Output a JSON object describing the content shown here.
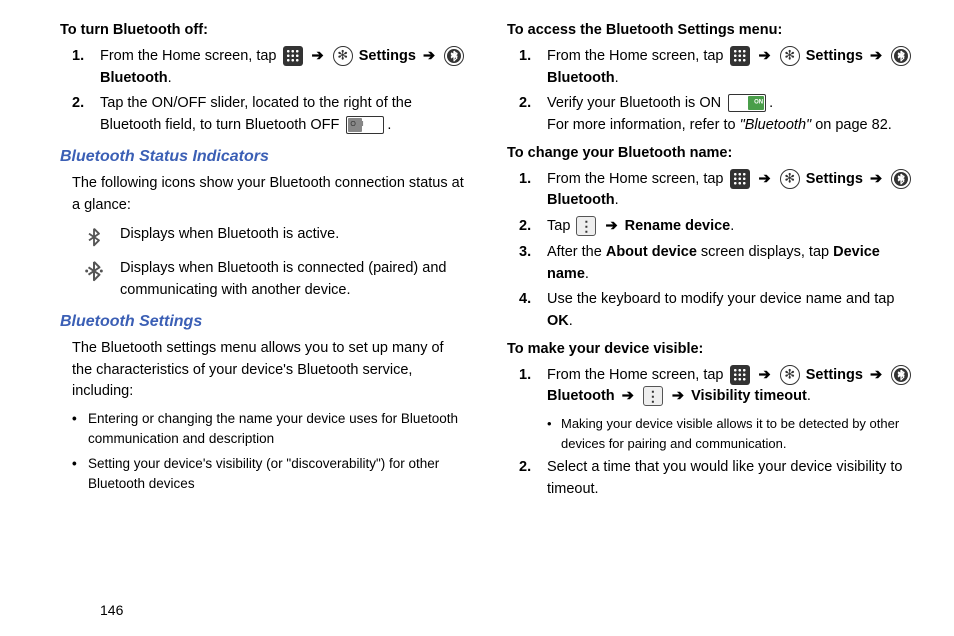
{
  "left": {
    "h_turn_off": "To turn Bluetooth off:",
    "off_steps": [
      {
        "pre": "From the Home screen, tap ",
        "mid": "Settings",
        "post": " ",
        "bt": "Bluetooth",
        "tail": "."
      },
      {
        "pre": "Tap the ON/OFF slider, located to the right of the Bluetooth field, to turn Bluetooth OFF ",
        "tail": "."
      }
    ],
    "h_status": "Bluetooth Status Indicators",
    "status_intro": "The following icons show your Bluetooth connection status at a glance:",
    "status_active": "Displays when Bluetooth is active.",
    "status_paired": "Displays when Bluetooth is connected (paired) and communicating with another device.",
    "h_settings": "Bluetooth Settings",
    "settings_intro": "The Bluetooth settings menu allows you to set up many of the characteristics of your device's Bluetooth service, including:",
    "bullets": [
      "Entering or changing the name your device uses for Bluetooth communication and description",
      "Setting your device's visibility (or \"discoverability\") for other Bluetooth devices"
    ]
  },
  "right": {
    "h_access": "To access the Bluetooth Settings menu:",
    "access_step1": {
      "pre": "From the Home screen, tap ",
      "settings": "Settings",
      "bt": "Bluetooth",
      "tail": "."
    },
    "access_step2_pre": "Verify your Bluetooth is ON ",
    "access_step2_tail": ".",
    "access_info_pre": "For more information, refer to ",
    "access_info_ref": "\"Bluetooth\"",
    "access_info_post": " on page 82.",
    "h_change": "To change your Bluetooth name:",
    "change_step1": {
      "pre": "From the Home screen, tap ",
      "settings": "Settings",
      "bt": "Bluetooth",
      "tail": "."
    },
    "change_step2_pre": "Tap ",
    "change_step2_rename": "Rename device",
    "change_step2_tail": ".",
    "change_step3_pre": "After the ",
    "change_step3_about": "About device",
    "change_step3_mid": " screen displays, tap ",
    "change_step3_devname": "Device name",
    "change_step3_tail": ".",
    "change_step4_pre": "Use the keyboard to modify your device name and tap ",
    "change_step4_ok": "OK",
    "change_step4_tail": ".",
    "h_visible": "To make your device visible:",
    "vis_step1": {
      "pre": "From the Home screen, tap ",
      "settings": "Settings",
      "bt": "Bluetooth",
      "visto": "Visibility timeout",
      "tail": "."
    },
    "vis_note": "Making your device visible allows it to be detected by other devices for pairing and communication.",
    "vis_step2": "Select a time that you would like your device visibility to timeout."
  },
  "page_number": "146",
  "arrow": "➔"
}
